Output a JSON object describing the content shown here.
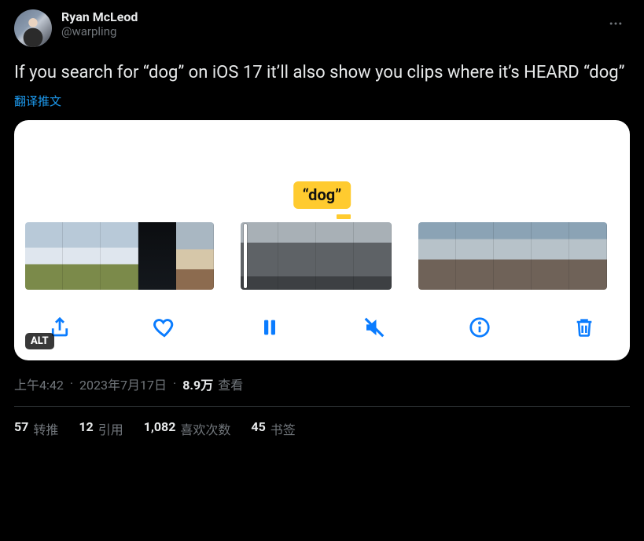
{
  "author": {
    "display_name": "Ryan McLeod",
    "handle": "@warpling"
  },
  "tweet_text": "If you search for “dog” on iOS 17 it’ll also show you clips where it’s HEARD “dog”",
  "translate_label": "翻译推文",
  "media": {
    "alt_badge": "ALT",
    "snippet_label": "“dog”",
    "toolbar_icons": {
      "share": "share-icon",
      "like": "heart-icon",
      "pause": "pause-icon",
      "mute": "mute-icon",
      "info": "info-icon",
      "delete": "trash-icon"
    }
  },
  "timestamp": {
    "time": "上午4:42",
    "date": "2023年7月17日",
    "views_count": "8.9万",
    "views_label": "查看"
  },
  "stats": {
    "retweets": {
      "count": "57",
      "label": "转推"
    },
    "quotes": {
      "count": "12",
      "label": "引用"
    },
    "likes": {
      "count": "1,082",
      "label": "喜欢次数"
    },
    "bookmarks": {
      "count": "45",
      "label": "书签"
    }
  }
}
